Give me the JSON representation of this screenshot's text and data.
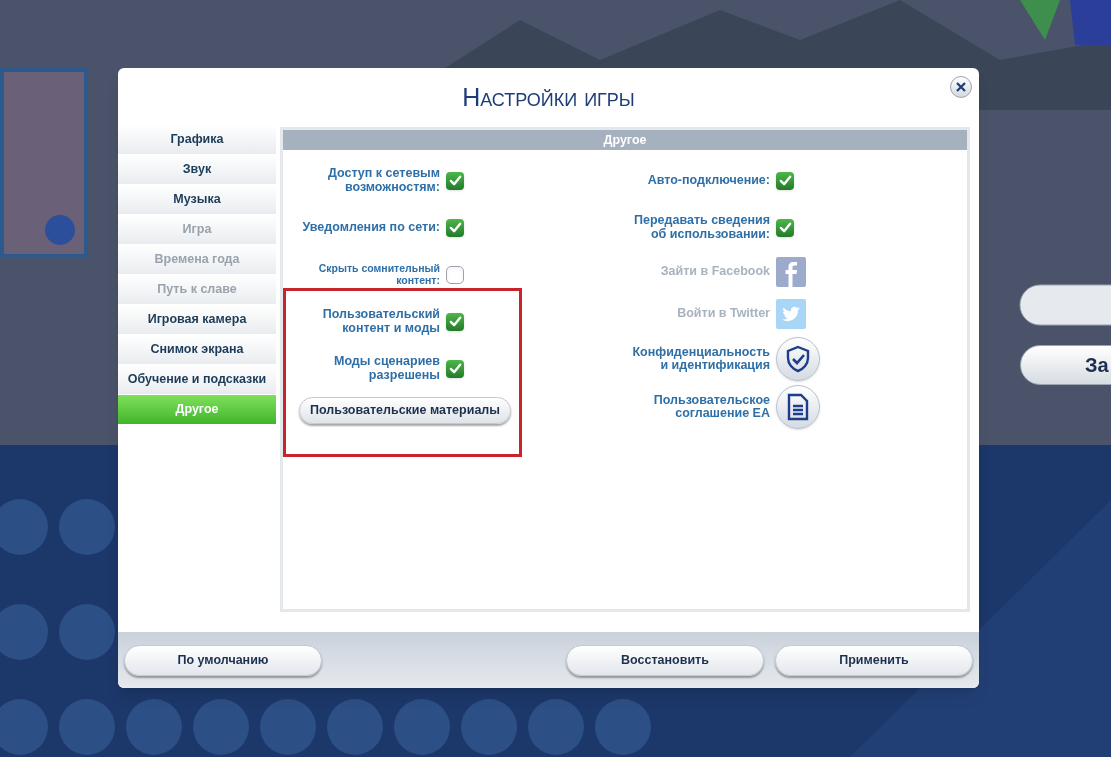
{
  "background": {
    "side_buttons": [
      {
        "label": "За"
      }
    ]
  },
  "dialog": {
    "title": "Настройки игры",
    "sidebar": {
      "items": [
        {
          "label": "Графика",
          "selected": false,
          "disabled": false
        },
        {
          "label": "Звук",
          "selected": false,
          "disabled": false
        },
        {
          "label": "Музыка",
          "selected": false,
          "disabled": false
        },
        {
          "label": "Игра",
          "selected": false,
          "disabled": true
        },
        {
          "label": "Времена года",
          "selected": false,
          "disabled": true
        },
        {
          "label": "Путь к славе",
          "selected": false,
          "disabled": true
        },
        {
          "label": "Игровая камера",
          "selected": false,
          "disabled": false
        },
        {
          "label": "Снимок экрана",
          "selected": false,
          "disabled": false
        },
        {
          "label": "Обучение и подсказки",
          "selected": false,
          "disabled": false
        },
        {
          "label": "Другое",
          "selected": true,
          "disabled": false
        }
      ]
    },
    "panel": {
      "title": "Другое",
      "left": [
        {
          "kind": "checkbox",
          "label": "Доступ к сетевым\nвозможностям:",
          "checked": true,
          "small": false
        },
        {
          "kind": "checkbox",
          "label": "Уведомления по сети:",
          "checked": true,
          "small": false
        },
        {
          "kind": "checkbox",
          "label": "Скрыть сомнительный\nконтент:",
          "checked": false,
          "small": true
        },
        {
          "kind": "checkbox",
          "label": "Пользовательский\nконтент и моды",
          "checked": true,
          "small": false
        },
        {
          "kind": "checkbox",
          "label": "Моды сценариев\nразрешены",
          "checked": true,
          "small": false
        },
        {
          "kind": "button",
          "label": "Пользовательские материалы"
        }
      ],
      "right": [
        {
          "kind": "checkbox",
          "label": "Авто-подключение:",
          "checked": true,
          "small": false
        },
        {
          "kind": "checkbox",
          "label": "Передавать сведения\nоб использовании:",
          "checked": true,
          "small": false
        },
        {
          "kind": "facebook",
          "label": "Зайти в Facebook",
          "disabled": true
        },
        {
          "kind": "twitter",
          "label": "Войти в Twitter",
          "disabled": true
        },
        {
          "kind": "privacy",
          "label": "Конфиденциальность\nи идентификация",
          "disabled": false
        },
        {
          "kind": "agreement",
          "label": "Пользовательское\nсоглашение EA",
          "disabled": false
        }
      ]
    },
    "footer": {
      "left_buttons": [
        "По умолчанию"
      ],
      "right_buttons": [
        "Восстановить",
        "Применить"
      ]
    }
  }
}
